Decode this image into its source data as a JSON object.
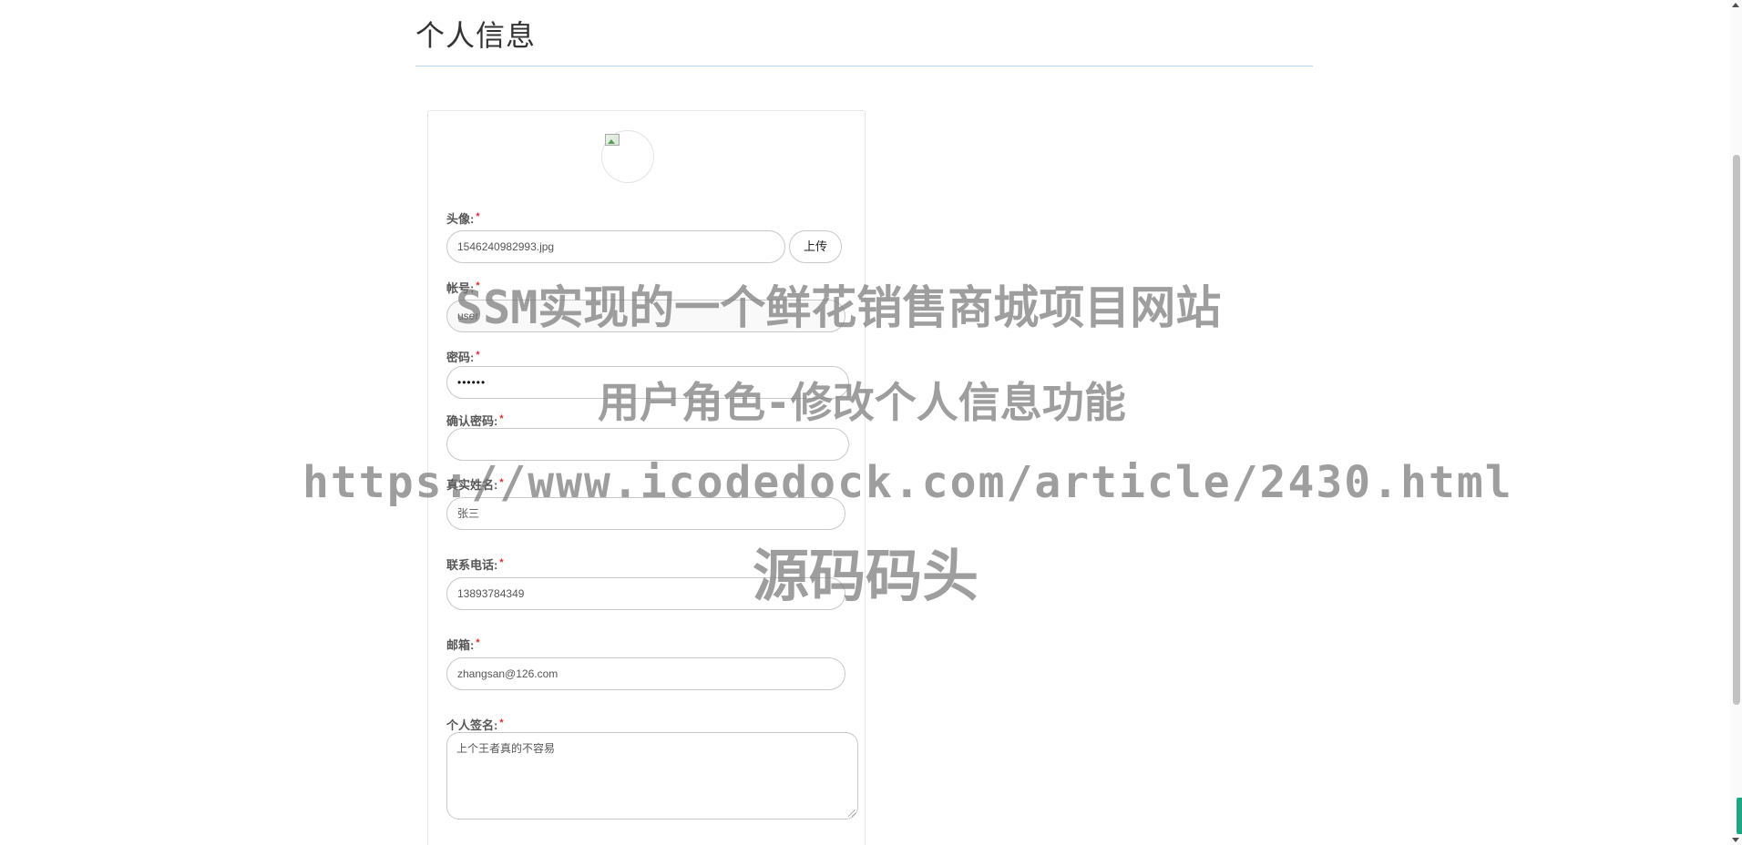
{
  "page": {
    "title": "个人信息"
  },
  "form": {
    "avatar": {
      "label": "头像:",
      "value": "1546240982993.jpg",
      "upload_label": "上传"
    },
    "account": {
      "label": "帐号:",
      "value": "user"
    },
    "password": {
      "label": "密码:",
      "value": "••••••"
    },
    "confirm_password": {
      "label": "确认密码:",
      "value": ""
    },
    "real_name": {
      "label": "真实姓名:",
      "value": "张三"
    },
    "phone": {
      "label": "联系电话:",
      "value": "13893784349"
    },
    "email": {
      "label": "邮箱:",
      "value": "zhangsan@126.com"
    },
    "signature": {
      "label": "个人签名:",
      "value": "上个王者真的不容易"
    },
    "required_mark": "*"
  },
  "watermark": {
    "line1": "SSM实现的一个鲜花销售商城项目网站",
    "line2": "用户角色-修改个人信息功能",
    "line3": "https://www.icodedock.com/article/2430.html",
    "line4": "源码码头"
  },
  "colors": {
    "accent_rule": "#b8d4ee",
    "required": "#e03030",
    "side_tab": "#1ba784"
  }
}
